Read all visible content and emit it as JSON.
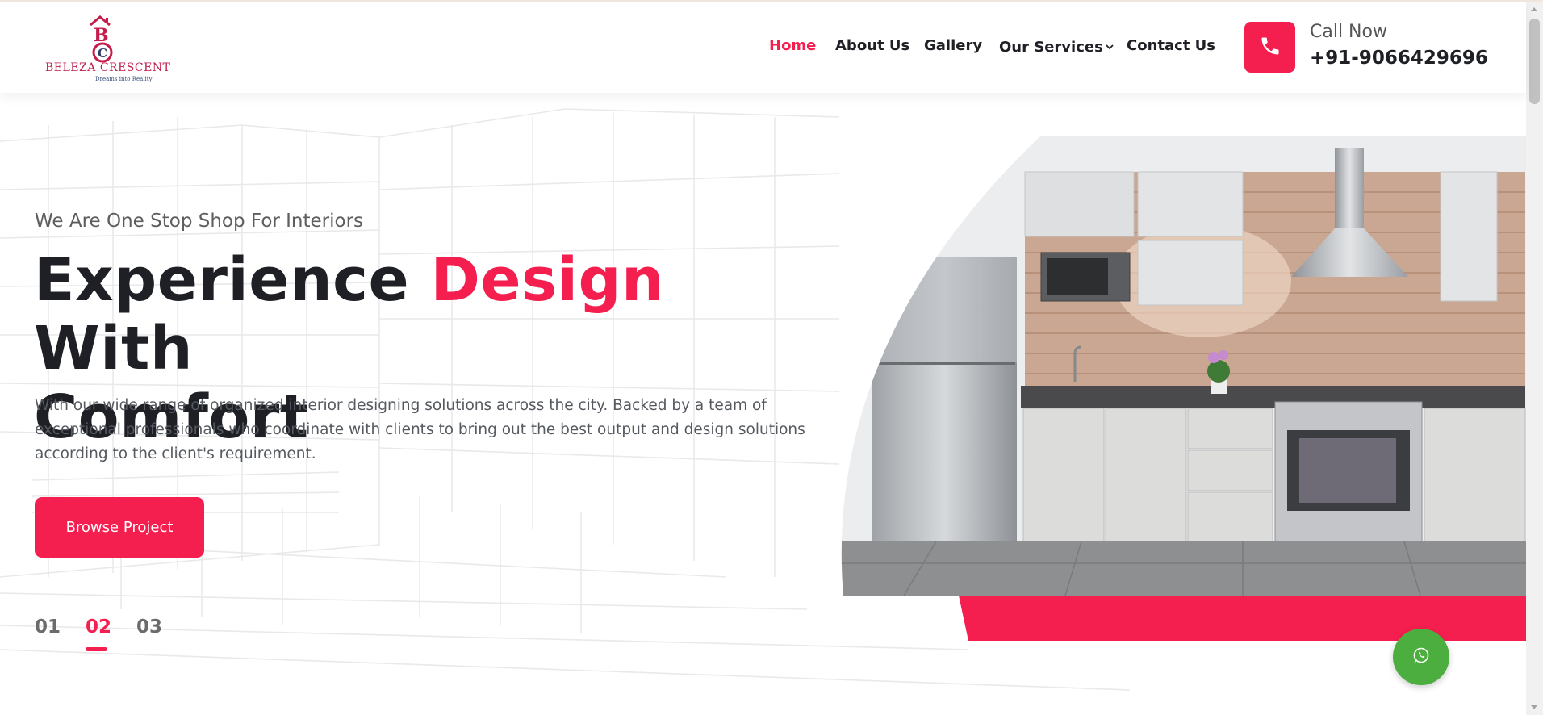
{
  "brand": {
    "name": "BELEZA CRESCENT",
    "tagline": "Dreams into Reality",
    "accent_color": "#f41e4f",
    "logo_color": "#c41d4c"
  },
  "nav": {
    "items": [
      {
        "label": "Home",
        "active": true
      },
      {
        "label": "About Us",
        "active": false
      },
      {
        "label": "Gallery",
        "active": false
      },
      {
        "label": "Our Services",
        "active": false,
        "has_dropdown": true
      },
      {
        "label": "Contact Us",
        "active": false
      }
    ]
  },
  "call": {
    "icon": "phone-icon",
    "label": "Call Now",
    "number": "+91-9066429696"
  },
  "hero": {
    "subtitle": "We Are One Stop Shop For Interiors",
    "title_part1": "Experience",
    "title_accent": "Design",
    "title_part2": "With",
    "title_line2": "Comfort",
    "description": "With our wide range of organized interior designing solutions across the city. Backed by a team of exceptional professionals who coordinate with clients to bring out the best output and design solutions according to the client's requirement.",
    "button_label": "Browse Project",
    "slides": [
      "01",
      "02",
      "03"
    ],
    "active_slide": "02"
  },
  "floating": {
    "whatsapp_icon": "whatsapp-icon",
    "whatsapp_color": "#4cae3e"
  }
}
